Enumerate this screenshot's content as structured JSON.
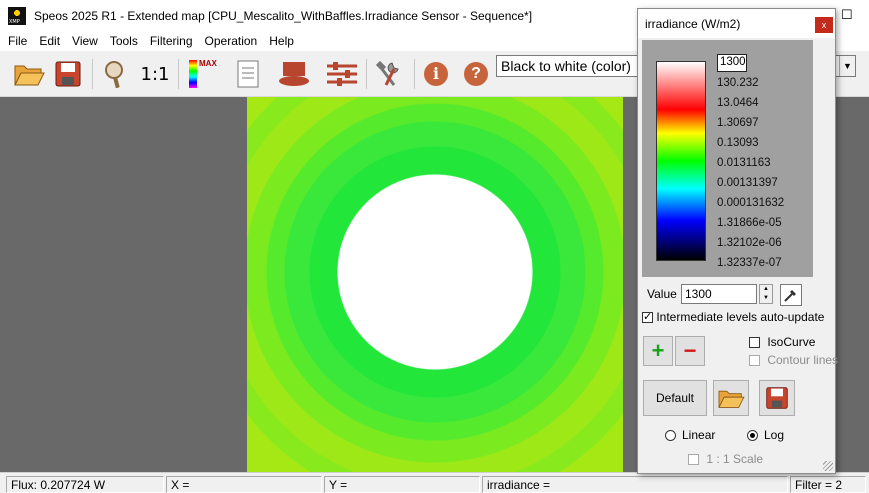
{
  "window": {
    "title": "Speos 2025 R1 - Extended map [CPU_Mescalito_WithBaffles.Irradiance Sensor - Sequence*]",
    "minimize_glyph": "—",
    "maximize_glyph": "☐"
  },
  "menu": [
    {
      "label": "File"
    },
    {
      "label": "Edit"
    },
    {
      "label": "View"
    },
    {
      "label": "Tools"
    },
    {
      "label": "Filtering"
    },
    {
      "label": "Operation"
    },
    {
      "label": "Help"
    }
  ],
  "toolbar": {
    "buttons": [
      {
        "icon": "open-folder-icon"
      },
      {
        "icon": "save-icon"
      },
      {
        "icon": "zoom-icon"
      },
      {
        "icon": "zoom-1-1-icon",
        "text": "1:1"
      },
      {
        "icon": "color-scale-max-icon",
        "text": "MAX"
      },
      {
        "icon": "report-icon"
      },
      {
        "icon": "layer-icon"
      },
      {
        "icon": "sliders-icon"
      },
      {
        "icon": "tools-icon"
      },
      {
        "icon": "info-icon",
        "text": "i"
      },
      {
        "icon": "help-icon",
        "text": "?"
      }
    ],
    "palette": {
      "selected": "Black to white (color)"
    }
  },
  "status": {
    "flux": "Flux: 0.207724 W",
    "x": "X =",
    "y": "Y =",
    "irradiance": "irradiance =",
    "filter": "Filter = 2"
  },
  "panel": {
    "title": "irradiance (W/m2)",
    "close": "x",
    "legend": {
      "max": "1300",
      "labels": [
        "130.232",
        "13.0464",
        "1.30697",
        "0.13093",
        "0.0131163",
        "0.00131397",
        "0.000131632",
        "1.31866e-05",
        "1.32102e-06",
        "1.32337e-07"
      ]
    },
    "value_label": "Value",
    "value": "1300",
    "auto_update": {
      "label": "Intermediate levels auto-update",
      "checked": true
    },
    "add_button": "+",
    "remove_button": "−",
    "isocurve": {
      "label": "IsoCurve",
      "checked": false
    },
    "contour_lines": {
      "label": "Contour lines",
      "checked": false,
      "enabled": false
    },
    "default_button": "Default",
    "scale": {
      "linear": "Linear",
      "log": "Log",
      "selected": "Log"
    },
    "one_to_one": {
      "label": "1 : 1 Scale",
      "checked": false,
      "enabled": false
    }
  }
}
